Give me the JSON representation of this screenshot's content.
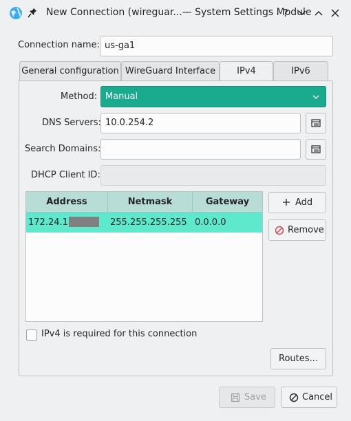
{
  "window": {
    "title": "New Connection (wireguar...— System Settings Module",
    "help": "?"
  },
  "connection_name": {
    "label": "Connection name:",
    "value": "us-ga1"
  },
  "tabs": [
    {
      "label": "General configuration",
      "active": false
    },
    {
      "label": "WireGuard Interface",
      "active": false
    },
    {
      "label": "IPv4",
      "active": true
    },
    {
      "label": "IPv6",
      "active": false
    }
  ],
  "ipv4": {
    "method": {
      "label": "Method:",
      "value": "Manual"
    },
    "dns": {
      "label": "DNS Servers:",
      "value": "10.0.254.2"
    },
    "search_domains": {
      "label": "Search Domains:",
      "value": ""
    },
    "dhcp_client_id": {
      "label": "DHCP Client ID:",
      "value": ""
    },
    "table": {
      "headers": [
        "Address",
        "Netmask",
        "Gateway"
      ],
      "rows": [
        {
          "address": "172.24.1",
          "netmask": "255.255.255.255",
          "gateway": "0.0.0.0"
        }
      ]
    },
    "add_label": "Add",
    "remove_label": "Remove",
    "required_label": "IPv4 is required for this connection",
    "routes_label": "Routes..."
  },
  "footer": {
    "save_label": "Save",
    "cancel_label": "Cancel"
  },
  "colors": {
    "accent": "#1aab8e",
    "selected_row": "#5ee8cc",
    "header": "#b8ddd6"
  }
}
